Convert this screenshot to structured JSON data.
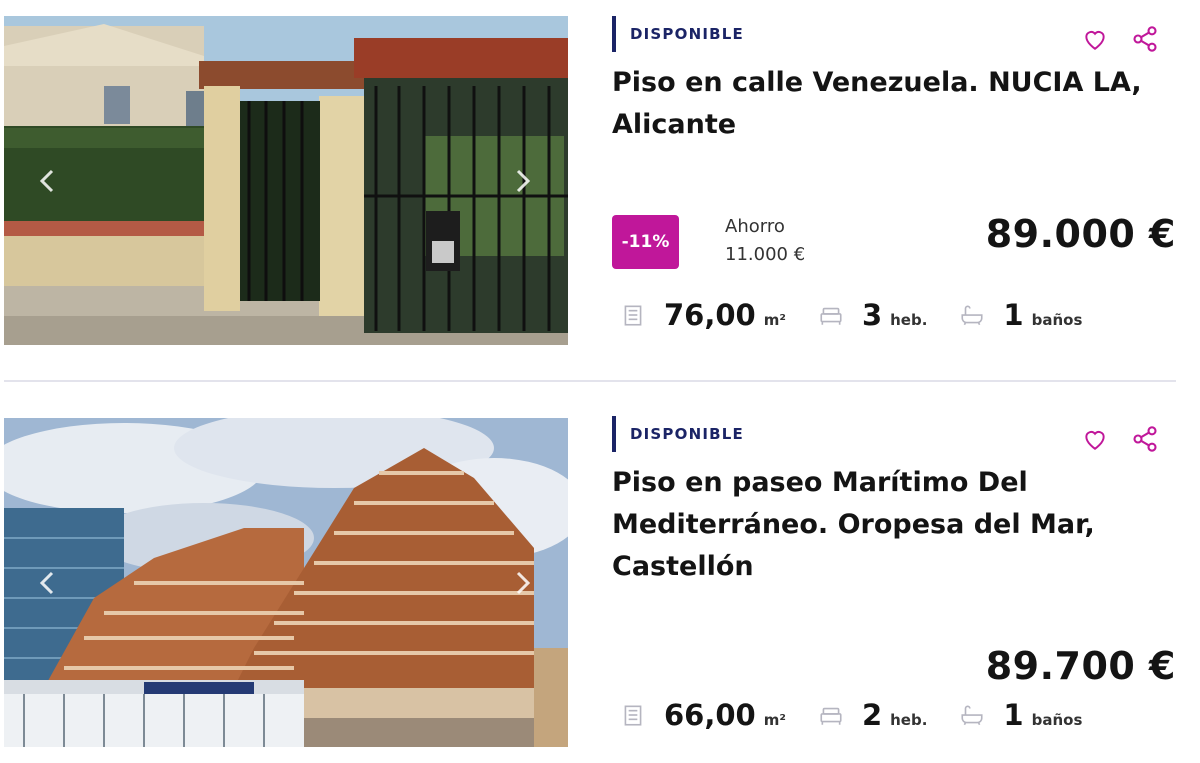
{
  "listings": [
    {
      "status": "DISPONIBLE",
      "title": "Piso en calle Venezuela. NUCIA LA, Alicante",
      "discount": "-11%",
      "saving_label": "Ahorro",
      "saving_amount": "11.000 €",
      "price": "89.000 €",
      "area_value": "76,00",
      "area_unit": "m²",
      "rooms_value": "3",
      "rooms_unit": "heb.",
      "baths_value": "1",
      "baths_unit": "baños"
    },
    {
      "status": "DISPONIBLE",
      "title": "Piso en paseo Marítimo Del Mediterráneo. Oropesa del Mar, Castellón",
      "price": "89.700 €",
      "area_value": "66,00",
      "area_unit": "m²",
      "rooms_value": "2",
      "rooms_unit": "heb.",
      "baths_value": "1",
      "baths_unit": "baños"
    }
  ],
  "icons": {
    "favorite": "heart-icon",
    "share": "share-icon",
    "area": "area-icon",
    "rooms": "bed-icon",
    "baths": "bathtub-icon",
    "prev": "chevron-left-icon",
    "next": "chevron-right-icon"
  },
  "colors": {
    "accent": "#c0179a",
    "brand_navy": "#1b2466",
    "divider": "#e3e3ec"
  }
}
